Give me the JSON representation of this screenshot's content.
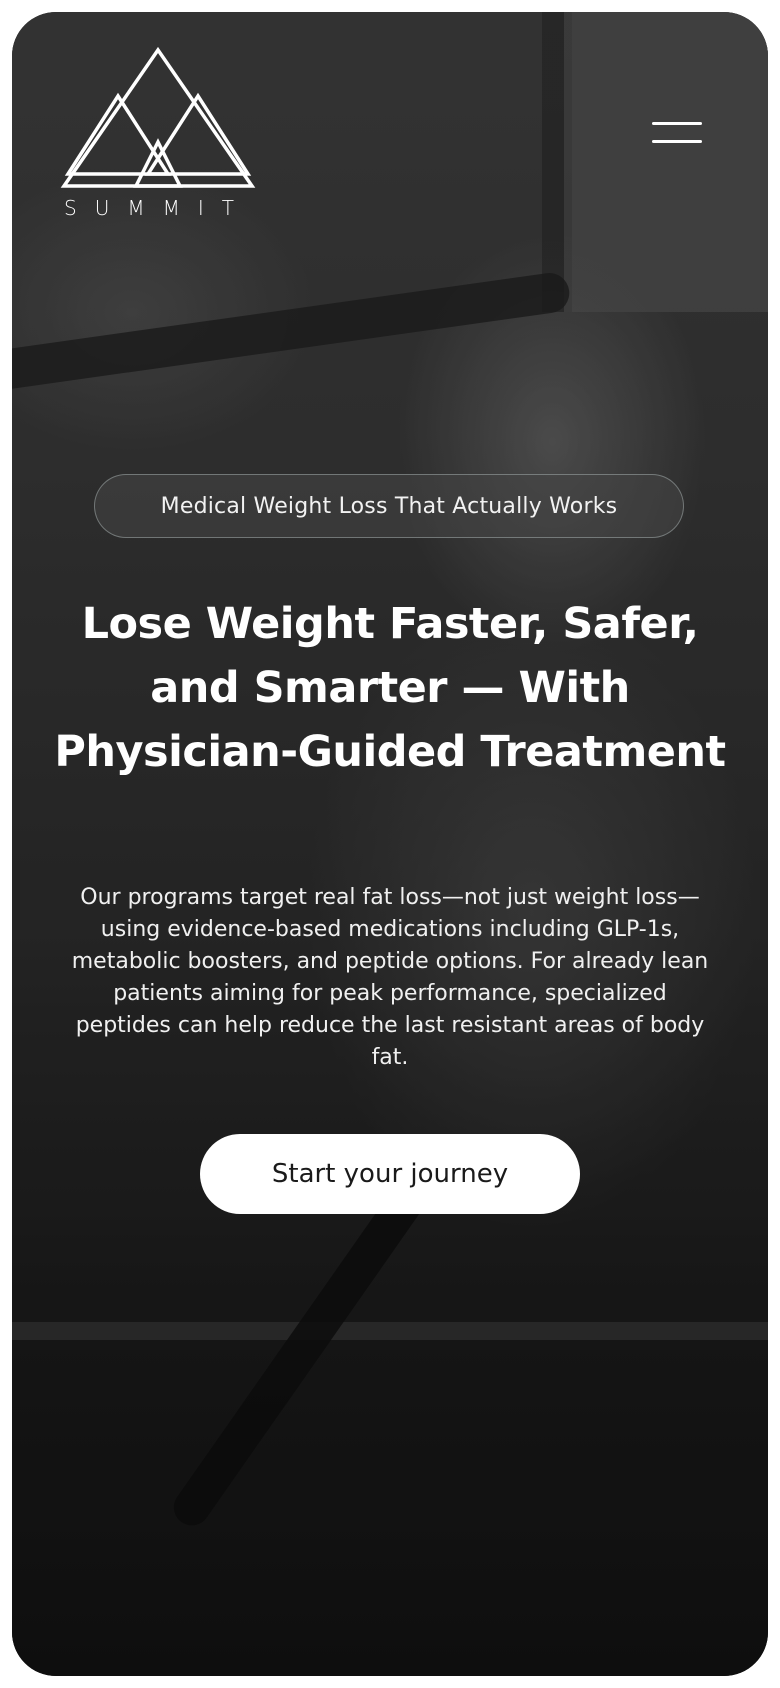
{
  "brand": {
    "name": "SUMMIT",
    "logo_icon": "mountain-triangles-logo"
  },
  "nav": {
    "menu_icon": "hamburger-menu-icon"
  },
  "hero": {
    "tagline": "Medical Weight Loss That Actually Works",
    "headline": "Lose Weight Faster, Safer, and Smarter — With Physician-Guided Treatment",
    "description": "Our programs target real fat loss—not just weight loss—using evidence-based medications including GLP-1s, metabolic boosters, and peptide options. For already lean patients aiming for peak performance, specialized peptides can help reduce the last resistant areas of body fat.",
    "cta_label": "Start your journey"
  },
  "colors": {
    "text": "#ffffff",
    "cta_background": "#ffffff",
    "cta_text": "#1a1a1a",
    "pill_border": "#a0aaaa"
  }
}
